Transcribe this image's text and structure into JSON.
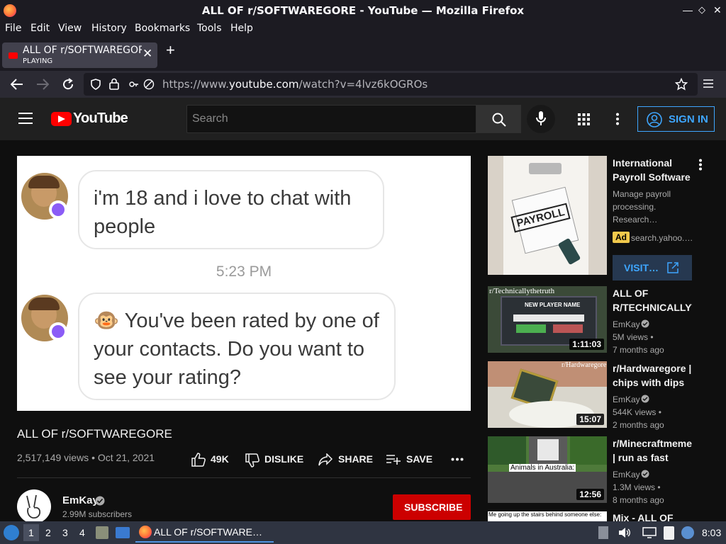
{
  "window": {
    "title": "ALL OF r/SOFTWAREGORE - YouTube — Mozilla Firefox"
  },
  "menu": [
    "File",
    "Edit",
    "View",
    "History",
    "Bookmarks",
    "Tools",
    "Help"
  ],
  "tab": {
    "title": "ALL OF r/SOFTWAREGOR",
    "status": "PLAYING"
  },
  "url": {
    "prefix": "https://www.",
    "domain": "youtube.com",
    "path": "/watch?v=4lvz6kOGROs"
  },
  "youtube": {
    "logo_text": "YouTube",
    "search_placeholder": "Search",
    "sign_in": "SIGN IN"
  },
  "video": {
    "chat": {
      "msg1": "i'm 18 and i love to chat with people",
      "time": "5:23 PM",
      "msg2": "🐵 You've been rated by one of your contacts. Do you want to see your rating?"
    },
    "title": "ALL OF r/SOFTWAREGORE",
    "meta": "2,517,149 views • Oct 21, 2021",
    "likes": "49K",
    "dislike": "DISLIKE",
    "share": "SHARE",
    "save": "SAVE",
    "channel": {
      "name": "EmKay",
      "subscribers": "2.99M subscribers"
    },
    "subscribe": "SUBSCRIBE"
  },
  "sidebar": {
    "ad": {
      "title": "International Payroll Software",
      "desc": "Manage payroll processing. Research…",
      "badge": "Ad",
      "source": "search.yahoo.…",
      "cta": "VISIT…",
      "thumb_text": "PAYROLL"
    },
    "items": [
      {
        "title": "ALL OF R/TECHNICALLYT",
        "channel": "EmKay",
        "views": "5M views •",
        "age": "7 months ago",
        "duration": "1:11:03",
        "thumb_caption": "r/Technicallythetruth"
      },
      {
        "title": "r/Hardwaregore | chips with dips",
        "channel": "EmKay",
        "views": "544K views •",
        "age": "2 months ago",
        "duration": "15:07",
        "thumb_caption": "r/Hardwaregore"
      },
      {
        "title": "r/Minecraftmemes | run as fast as…",
        "channel": "EmKay",
        "views": "1.3M views •",
        "age": "8 months ago",
        "duration": "12:56",
        "thumb_caption": "Animals in Australia:"
      },
      {
        "title": "Mix - ALL OF",
        "thumb_caption": "Me going up the stairs behind someone else:"
      }
    ]
  },
  "taskbar": {
    "workspaces": [
      "1",
      "2",
      "3",
      "4"
    ],
    "window": "ALL OF r/SOFTWARE…",
    "clock": "8:03"
  }
}
